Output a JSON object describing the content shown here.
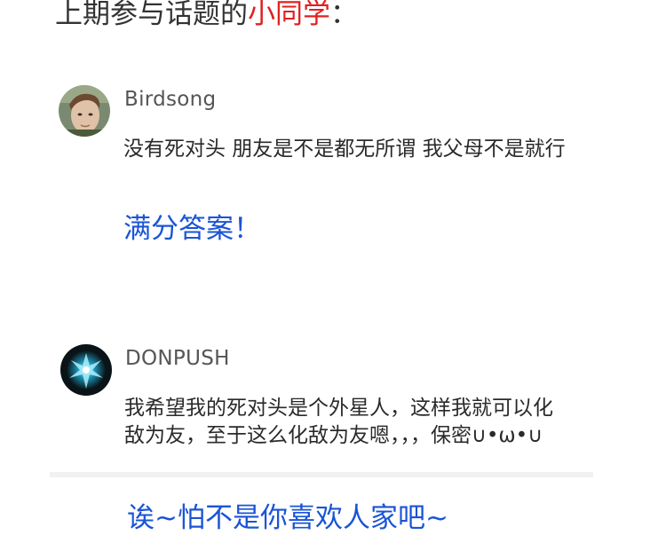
{
  "header": {
    "prefix": "上期参与话题的",
    "highlight": "小同学",
    "suffix": "："
  },
  "comments": [
    {
      "avatar_icon": "user-photo-avatar",
      "username": "Birdsong",
      "text": "没有死对头 朋友是不是都无所谓 我父母不是就行",
      "reply": "满分答案！"
    },
    {
      "avatar_icon": "blue-glow-avatar",
      "username": "DONPUSH",
      "text": "我希望我的死对头是个外星人，这样我就可以化敌为友，至于这么化敌为友嗯，，，保密∪•ω•∪",
      "reply": "诶~怕不是你喜欢人家吧~"
    }
  ],
  "colors": {
    "highlight": "#e02020",
    "reply": "#1a54d6",
    "text": "#2a2a2a",
    "username": "#555555"
  }
}
